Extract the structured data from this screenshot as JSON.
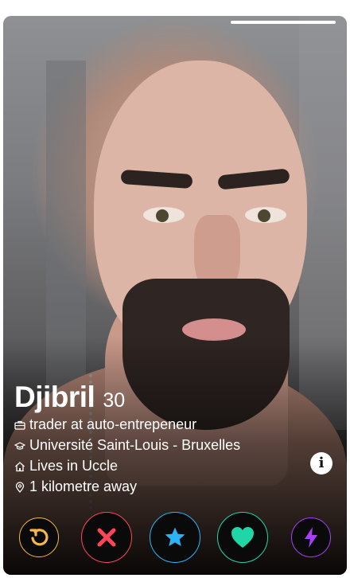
{
  "profile": {
    "name": "Djibril",
    "age": "30",
    "job": "trader at auto-entrepeneur",
    "school": "Université Saint-Louis - Bruxelles",
    "location": "Lives in Uccle",
    "distance": "1 kilometre away"
  },
  "photo_progress": 1.0,
  "info_button": {
    "label": "i"
  },
  "icons": {
    "job": "briefcase-icon",
    "school": "graduation-cap-icon",
    "location": "home-icon",
    "distance": "map-pin-icon"
  },
  "actions": [
    {
      "name": "rewind",
      "icon": "rewind-icon",
      "color": "#f5b748"
    },
    {
      "name": "nope",
      "icon": "close-icon",
      "color": "#ff4458"
    },
    {
      "name": "super-like",
      "icon": "star-icon",
      "color": "#2db3f5"
    },
    {
      "name": "like",
      "icon": "heart-icon",
      "color": "#1fd6a6"
    },
    {
      "name": "boost",
      "icon": "lightning-icon",
      "color": "#a740f5"
    }
  ]
}
